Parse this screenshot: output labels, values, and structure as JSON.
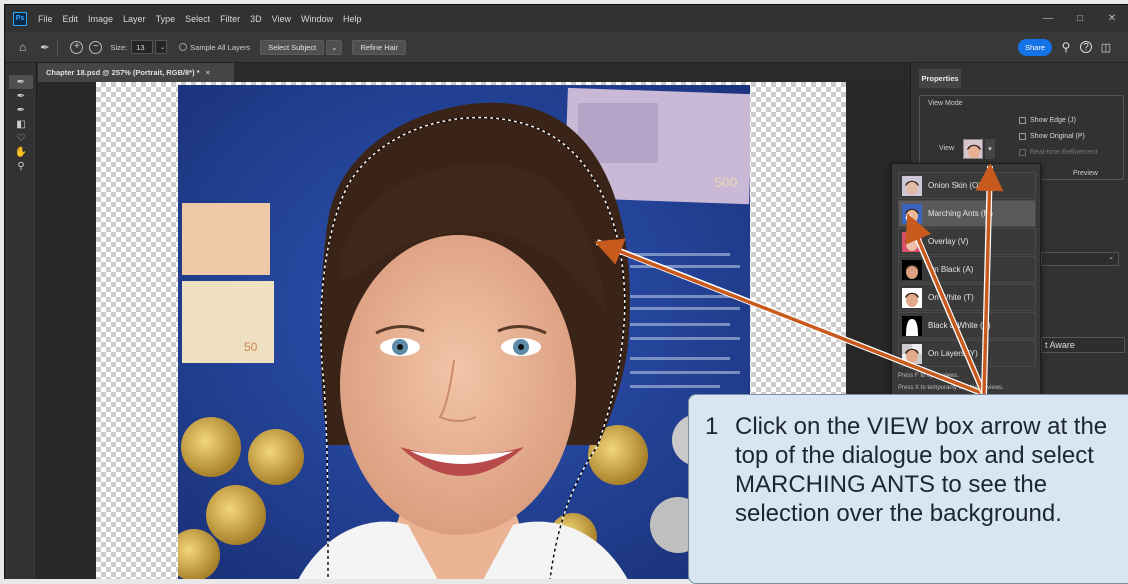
{
  "app": {
    "menu": [
      "File",
      "Edit",
      "Image",
      "Layer",
      "Type",
      "Select",
      "Filter",
      "3D",
      "View",
      "Window",
      "Help"
    ],
    "logo_text": "Ps"
  },
  "options_bar": {
    "size_label": "Size:",
    "size_value": "13",
    "sample_all_layers": "Sample All Layers",
    "select_subject": "Select Subject",
    "refine_hair": "Refine Hair",
    "share": "Share"
  },
  "document_tab": {
    "title": "Chapter 18.psd @ 257% (Portrait, RGB/8*) *",
    "close": "×"
  },
  "properties": {
    "tab_label": "Properties",
    "view_mode_label": "View Mode",
    "view_label": "View",
    "show_edge": "Show Edge (J)",
    "show_original": "Show Original (P)",
    "realtime_refinement": "Real-time Refinement",
    "preview": "Preview",
    "content_aware_partial": "t Aware"
  },
  "view_dropdown": {
    "items": [
      {
        "label": "Onion Skin (O)",
        "thumb": "onion"
      },
      {
        "label": "Marching Ants (M)",
        "thumb": "ants"
      },
      {
        "label": "Overlay (V)",
        "thumb": "overlay"
      },
      {
        "label": "On Black (A)",
        "thumb": "black"
      },
      {
        "label": "On White (T)",
        "thumb": "white"
      },
      {
        "label": "Black & White (K)",
        "thumb": "bw"
      },
      {
        "label": "On Layers (Y)",
        "thumb": "layers"
      }
    ],
    "selected_index": 1,
    "footer_1": "Press F to cycle views.",
    "footer_2": "Press X to temporarily disable all views."
  },
  "callout": {
    "number": "1",
    "lines": [
      "Click on the VIEW box arrow at the",
      "top of the dialogue box and select",
      "MARCHING ANTS to see the",
      "selection over the background."
    ]
  },
  "colors": {
    "accent": "#1473e6",
    "arrow": "#c85a1e",
    "callout_bg": "#d9e6f1"
  }
}
